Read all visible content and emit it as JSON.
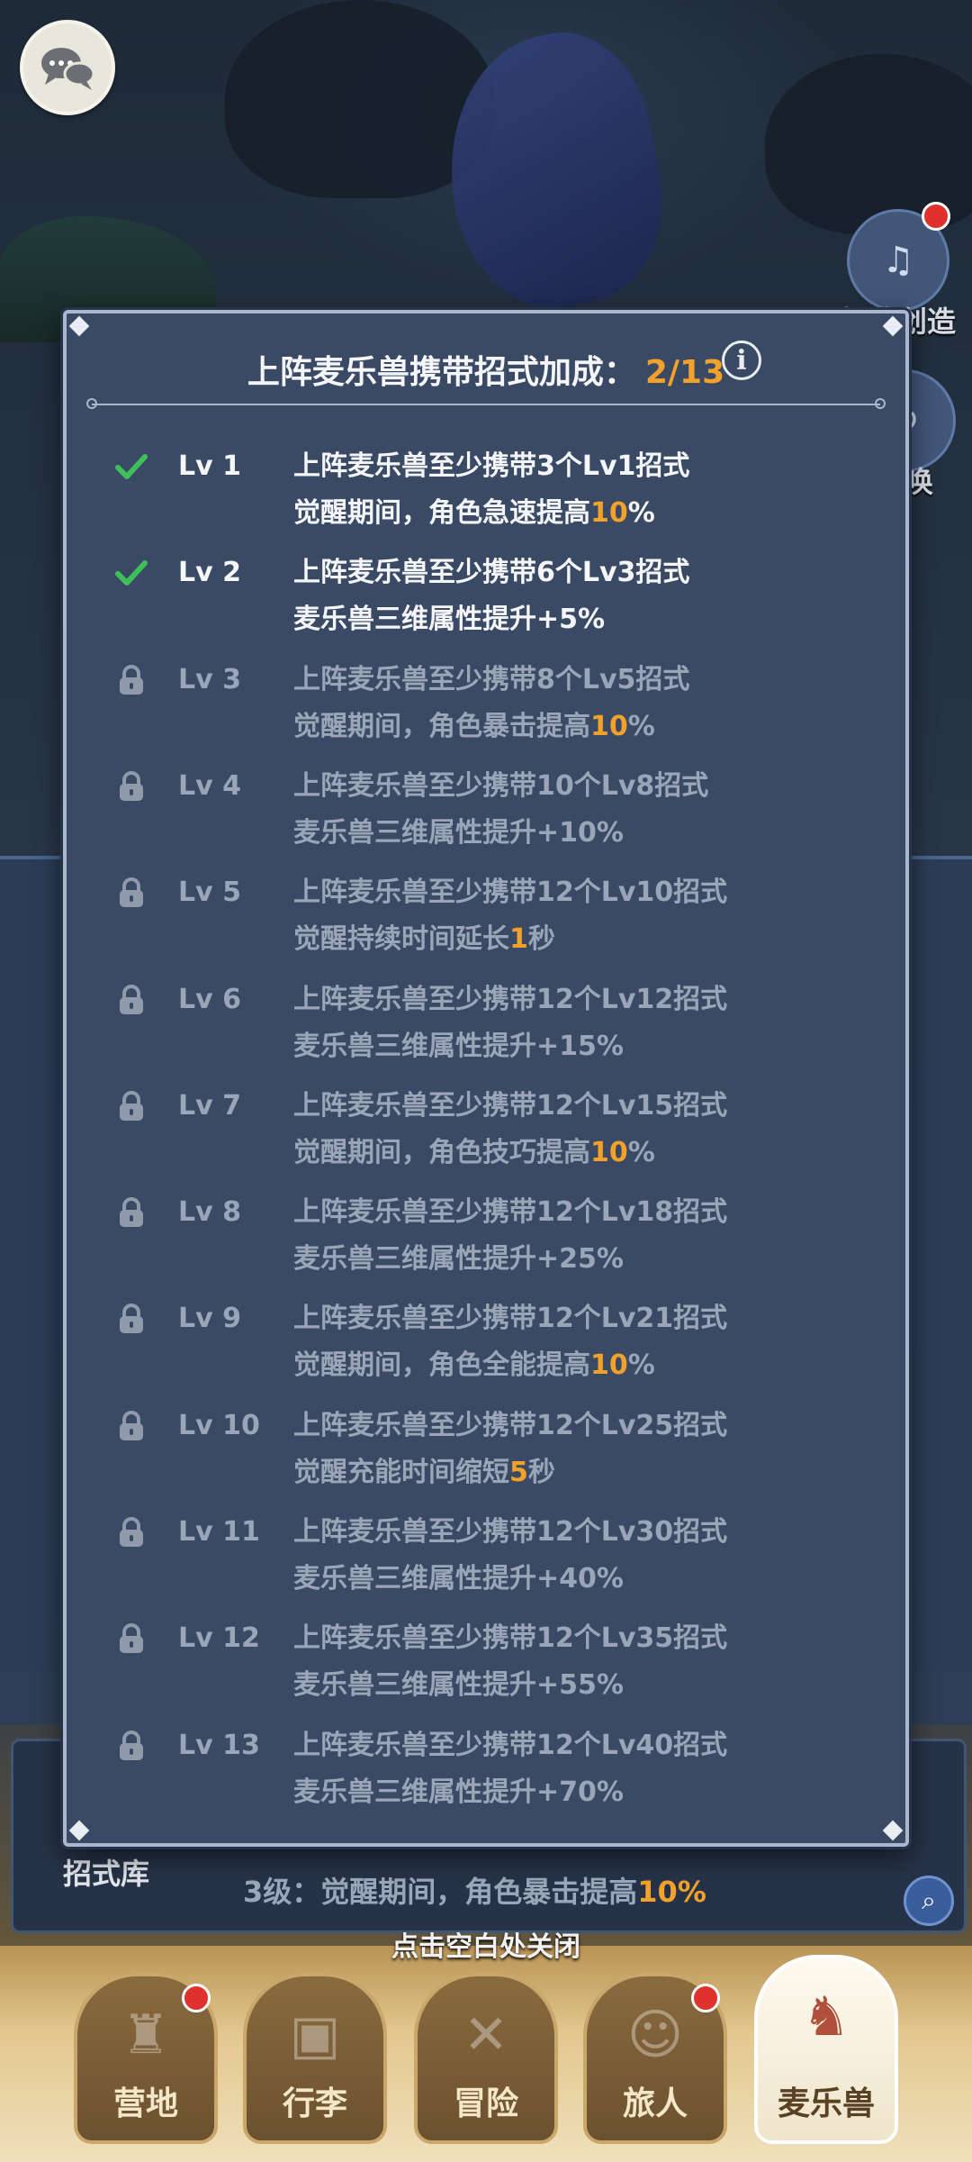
{
  "background": {
    "right_buttons": [
      "招式创造",
      "召唤"
    ],
    "skill_library_label": "招式库",
    "row_text_prefix": "3级：觉醒期间，角色暴击提高",
    "row_text_value": "10%"
  },
  "close_hint": "点击空白处关闭",
  "tabs": [
    "营地",
    "行李",
    "冒险",
    "旅人",
    "麦乐兽"
  ],
  "modal": {
    "title": "上阵麦乐兽携带招式加成：",
    "count": "2/13",
    "levels": [
      {
        "lv": "Lv 1",
        "status": "unlocked",
        "req": "上阵麦乐兽至少携带3个Lv1招式",
        "effect_pre": "觉醒期间，角色急速提高",
        "effect_hl": "10",
        "effect_post": "%"
      },
      {
        "lv": "Lv 2",
        "status": "unlocked",
        "req": "上阵麦乐兽至少携带6个Lv3招式",
        "effect_pre": "麦乐兽三维属性提升+5%",
        "effect_hl": "",
        "effect_post": ""
      },
      {
        "lv": "Lv 3",
        "status": "locked",
        "req": "上阵麦乐兽至少携带8个Lv5招式",
        "effect_pre": "觉醒期间，角色暴击提高",
        "effect_hl": "10",
        "effect_post": "%"
      },
      {
        "lv": "Lv 4",
        "status": "locked",
        "req": "上阵麦乐兽至少携带10个Lv8招式",
        "effect_pre": "麦乐兽三维属性提升+10%",
        "effect_hl": "",
        "effect_post": ""
      },
      {
        "lv": "Lv 5",
        "status": "locked",
        "req": "上阵麦乐兽至少携带12个Lv10招式",
        "effect_pre": "觉醒持续时间延长",
        "effect_hl": "1",
        "effect_post": "秒"
      },
      {
        "lv": "Lv 6",
        "status": "locked",
        "req": "上阵麦乐兽至少携带12个Lv12招式",
        "effect_pre": "麦乐兽三维属性提升+15%",
        "effect_hl": "",
        "effect_post": ""
      },
      {
        "lv": "Lv 7",
        "status": "locked",
        "req": "上阵麦乐兽至少携带12个Lv15招式",
        "effect_pre": "觉醒期间，角色技巧提高",
        "effect_hl": "10",
        "effect_post": "%"
      },
      {
        "lv": "Lv 8",
        "status": "locked",
        "req": "上阵麦乐兽至少携带12个Lv18招式",
        "effect_pre": "麦乐兽三维属性提升+25%",
        "effect_hl": "",
        "effect_post": ""
      },
      {
        "lv": "Lv 9",
        "status": "locked",
        "req": "上阵麦乐兽至少携带12个Lv21招式",
        "effect_pre": "觉醒期间，角色全能提高",
        "effect_hl": "10",
        "effect_post": "%"
      },
      {
        "lv": "Lv 10",
        "status": "locked",
        "req": "上阵麦乐兽至少携带12个Lv25招式",
        "effect_pre": "觉醒充能时间缩短",
        "effect_hl": "5",
        "effect_post": "秒"
      },
      {
        "lv": "Lv 11",
        "status": "locked",
        "req": "上阵麦乐兽至少携带12个Lv30招式",
        "effect_pre": "麦乐兽三维属性提升+40%",
        "effect_hl": "",
        "effect_post": ""
      },
      {
        "lv": "Lv 12",
        "status": "locked",
        "req": "上阵麦乐兽至少携带12个Lv35招式",
        "effect_pre": "麦乐兽三维属性提升+55%",
        "effect_hl": "",
        "effect_post": ""
      },
      {
        "lv": "Lv 13",
        "status": "locked",
        "req": "上阵麦乐兽至少携带12个Lv40招式",
        "effect_pre": "麦乐兽三维属性提升+70%",
        "effect_hl": "",
        "effect_post": ""
      }
    ]
  },
  "colors": {
    "accent": "#f2a12a",
    "check": "#3fbf5a",
    "lock": "#8f9aab"
  }
}
